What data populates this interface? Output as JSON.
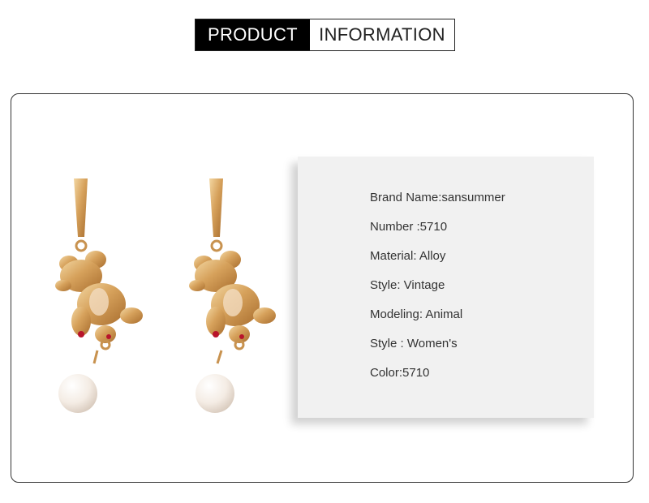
{
  "header": {
    "left_label": "PRODUCT",
    "right_label": "INFORMATION"
  },
  "product": {
    "image_icon": "bear-pearl-earrings-image"
  },
  "specs": [
    "Brand Name:sansummer",
    "Number :5710",
    "Material: Alloy",
    "Style: Vintage",
    "Modeling: Animal",
    "Style : Women's",
    "Color:5710"
  ],
  "colors": {
    "gold": "#d9a560",
    "pearl": "#f6efe8",
    "panel": "#f1f1f1"
  }
}
